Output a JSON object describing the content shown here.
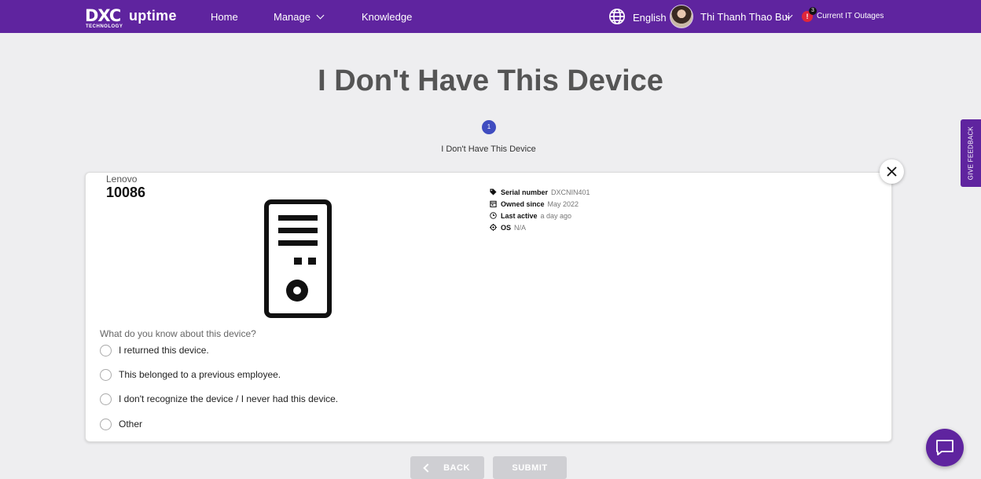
{
  "header": {
    "logo_main": "DXC",
    "logo_sub": "TECHNOLOGY",
    "product": "uptime",
    "nav": {
      "home": "Home",
      "manage": "Manage",
      "knowledge": "Knowledge"
    },
    "language": "English",
    "user_name": "Thi Thanh Thao Bui",
    "alert_badge": "!",
    "alert_count": "3",
    "outages_label": "Current IT Outages",
    "brand_color": "#5f249f"
  },
  "page": {
    "title": "I Don't Have This Device",
    "step_number": "1",
    "step_label": "I Don't Have This Device"
  },
  "device": {
    "brand": "Lenovo",
    "model": "10086",
    "icon": "desktop-tower-icon",
    "specs": [
      {
        "icon": "tag-icon",
        "label": "Serial number",
        "value": "DXCNIN401"
      },
      {
        "icon": "calendar-icon",
        "label": "Owned since",
        "value": "May 2022"
      },
      {
        "icon": "clock-icon",
        "label": "Last active",
        "value": "a day ago"
      },
      {
        "icon": "target-icon",
        "label": "OS",
        "value": "N/A"
      }
    ]
  },
  "form": {
    "question": "What do you know about this device?",
    "options": [
      "I returned this device.",
      "This belonged to a previous employee.",
      "I don't recognize the device / I never had this device.",
      "Other"
    ]
  },
  "buttons": {
    "back": "BACK",
    "submit": "SUBMIT"
  },
  "feedback_tab": "GIVE FEEDBACK",
  "chat": {
    "icon": "chat-bubble-icon"
  }
}
